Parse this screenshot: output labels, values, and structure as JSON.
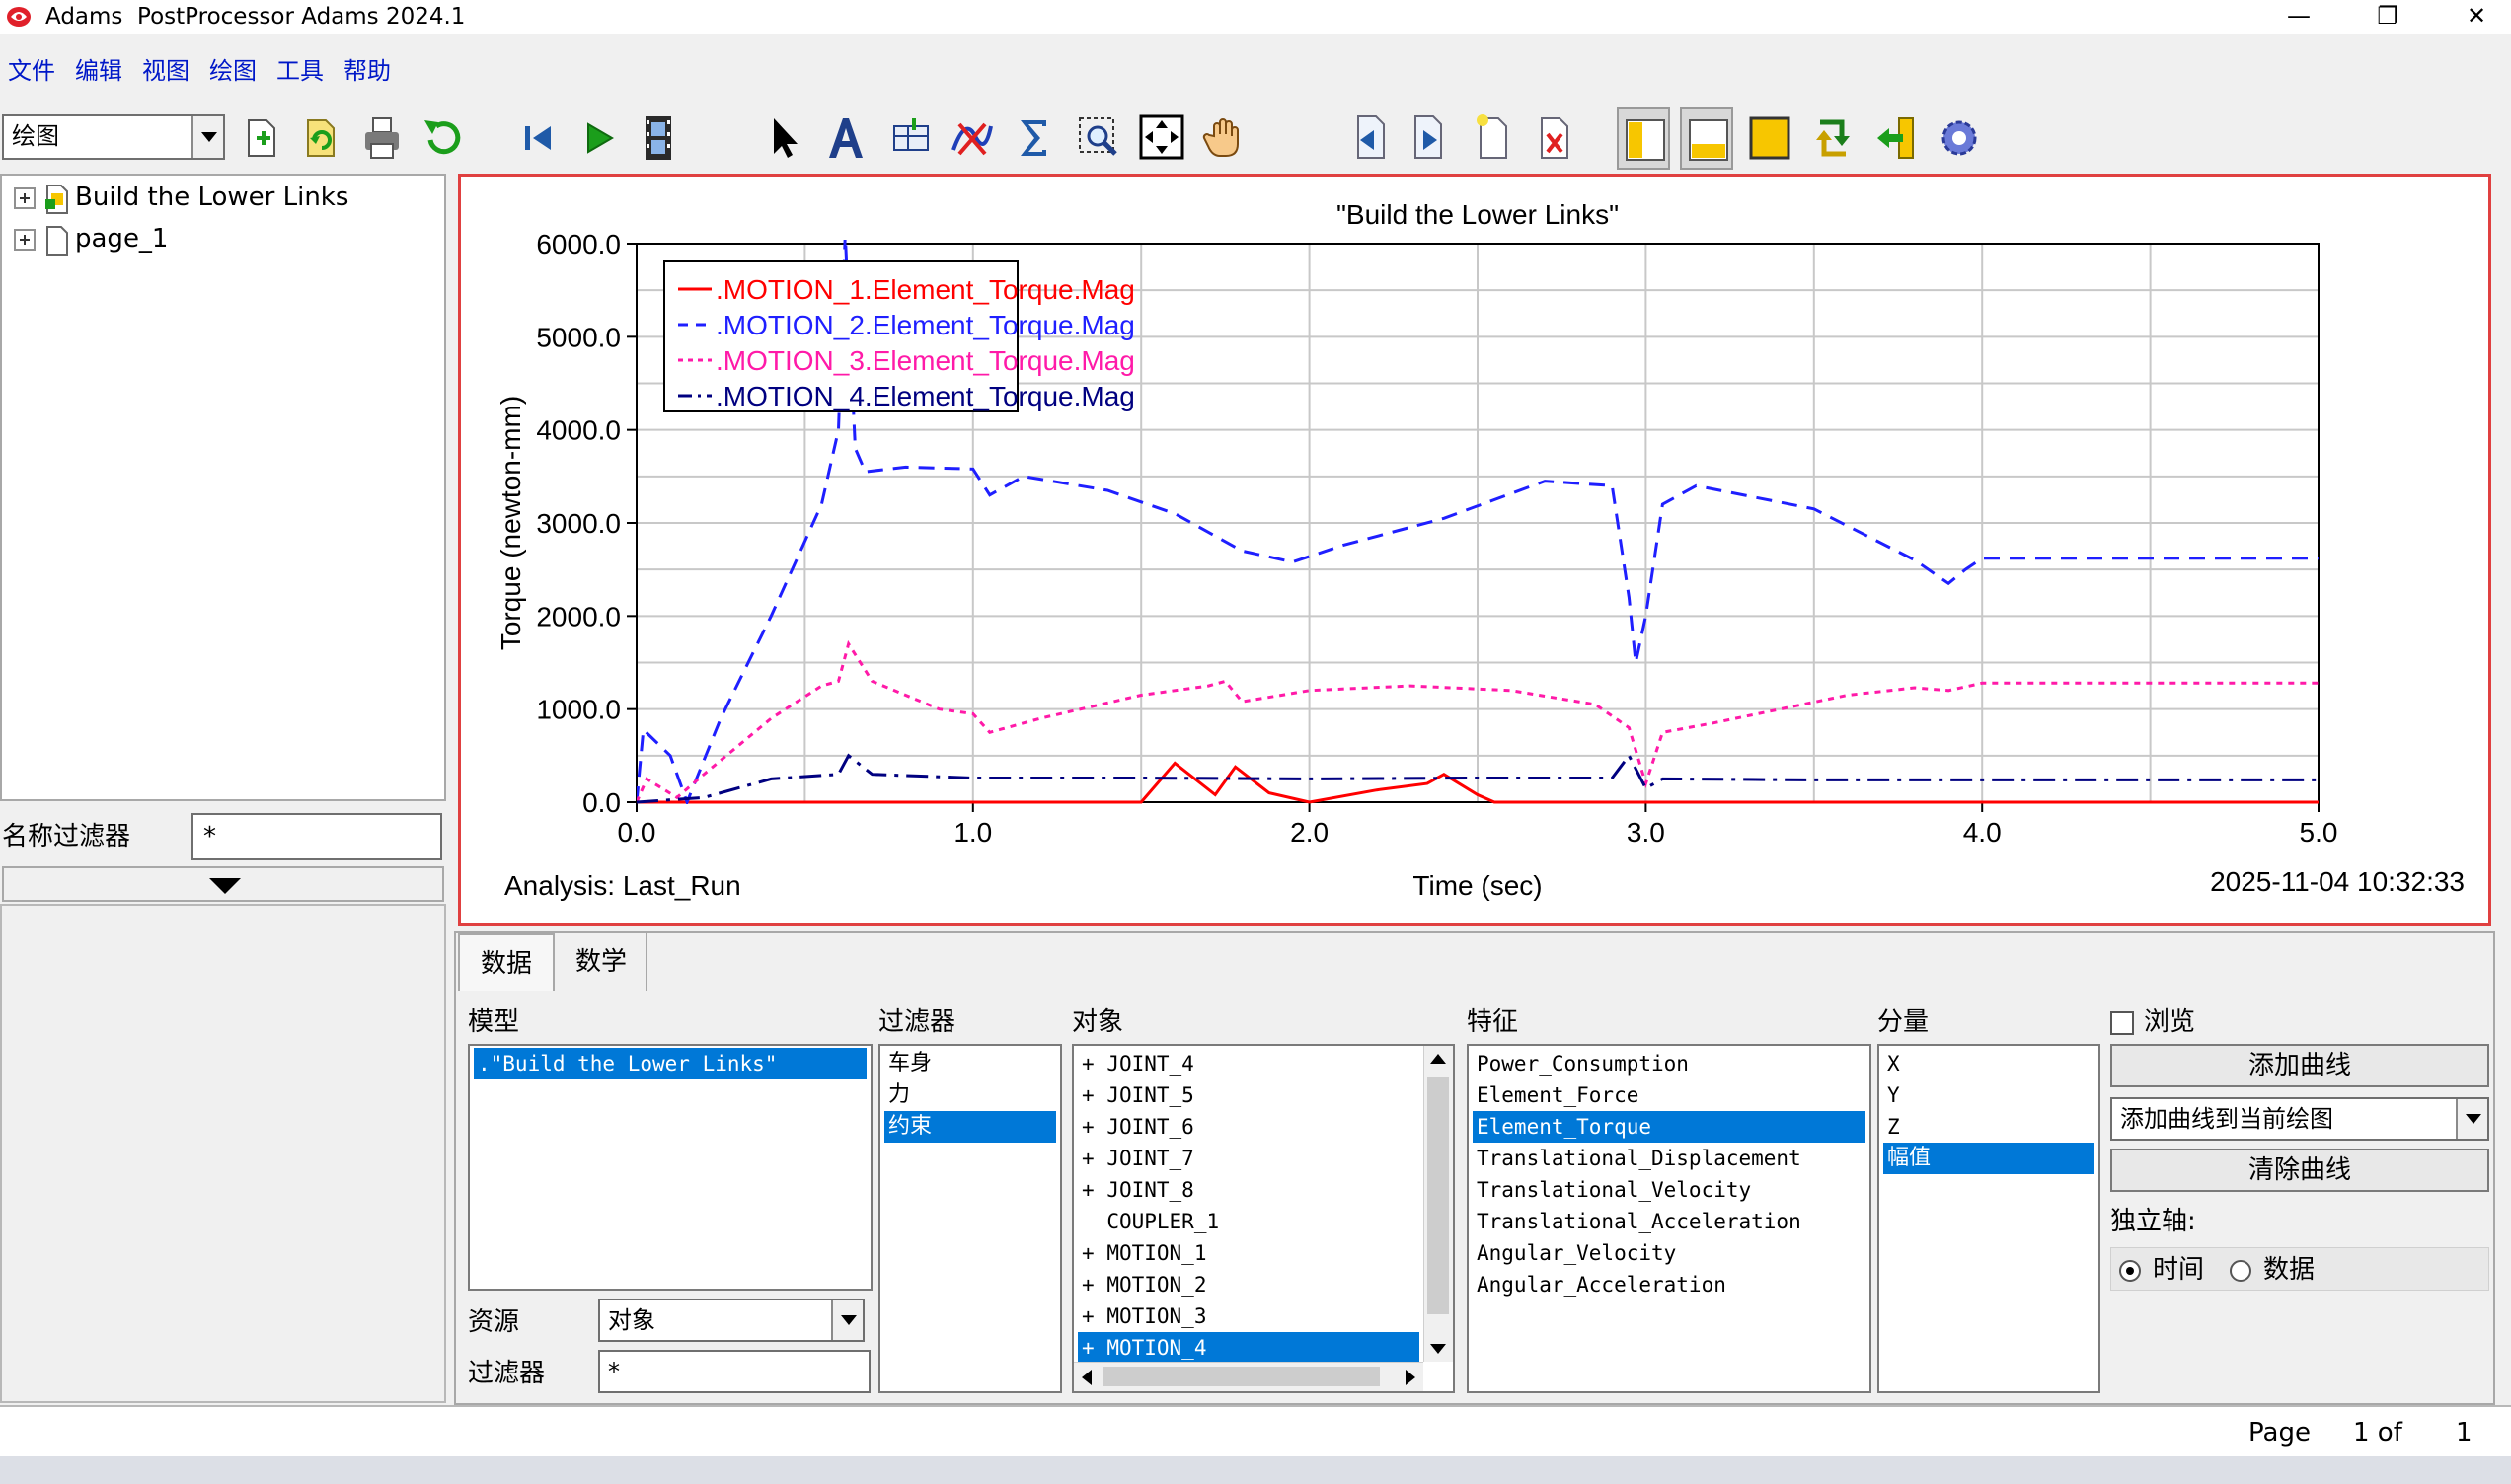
{
  "window": {
    "title": "Adams  PostProcessor Adams 2024.1",
    "controls": {
      "minimize": "—",
      "restore": "❐",
      "close": "✕"
    }
  },
  "menu": [
    "文件",
    "编辑",
    "视图",
    "绘图",
    "工具",
    "帮助"
  ],
  "toolbar": {
    "mode_select": "绘图",
    "icons": [
      "new-page-icon",
      "refresh-icon",
      "print-icon",
      "undo-icon",
      "first-frame-icon",
      "play-icon",
      "film-icon",
      "select-arrow-icon",
      "text-icon",
      "table-icon",
      "curve-edit-icon",
      "sum-icon",
      "zoom-box-icon",
      "fit-icon",
      "pan-hand-icon",
      "prev-page-icon",
      "next-page-icon",
      "new-page-sheet-icon",
      "delete-page-icon",
      "layout-split-left-icon",
      "layout-split-bottom-icon",
      "layout-single-icon",
      "swap-icon",
      "exit-icon",
      "settings-gear-icon"
    ]
  },
  "tree": {
    "items": [
      {
        "label": "Build the Lower Links",
        "icon": "model-icon"
      },
      {
        "label": "page_1",
        "icon": "page-icon"
      }
    ]
  },
  "name_filter": {
    "label": "名称过滤器",
    "value": "*"
  },
  "plot": {
    "analysis_label": "Analysis:  Last_Run",
    "timestamp": "2025-11-04 10:32:33"
  },
  "chart_data": {
    "type": "line",
    "title": "\"Build the Lower Links\"",
    "xlabel": "Time (sec)",
    "ylabel": "Torque (newton-mm)",
    "xlim": [
      0,
      5
    ],
    "ylim": [
      0,
      6000
    ],
    "x_ticks": [
      "0.0",
      "1.0",
      "2.0",
      "3.0",
      "4.0",
      "5.0"
    ],
    "y_ticks": [
      "0.0",
      "1000.0",
      "2000.0",
      "3000.0",
      "4000.0",
      "5000.0",
      "6000.0"
    ],
    "grid": true,
    "legend_position": "top-left",
    "series": [
      {
        "name": ".MOTION_1.Element_Torque.Mag",
        "color": "#ff0000",
        "dash": "solid",
        "points": [
          [
            0,
            0
          ],
          [
            1.5,
            0
          ],
          [
            1.6,
            420
          ],
          [
            1.72,
            80
          ],
          [
            1.78,
            380
          ],
          [
            1.88,
            100
          ],
          [
            2.0,
            0
          ],
          [
            2.2,
            130
          ],
          [
            2.35,
            200
          ],
          [
            2.4,
            300
          ],
          [
            2.5,
            80
          ],
          [
            2.55,
            0
          ],
          [
            5.0,
            0
          ]
        ]
      },
      {
        "name": ".MOTION_2.Element_Torque.Mag",
        "color": "#1f1fff",
        "dash": "dash",
        "points": [
          [
            0,
            0
          ],
          [
            0.02,
            780
          ],
          [
            0.1,
            500
          ],
          [
            0.15,
            0
          ],
          [
            0.25,
            900
          ],
          [
            0.4,
            2000
          ],
          [
            0.55,
            3200
          ],
          [
            0.6,
            4000
          ],
          [
            0.62,
            6100
          ],
          [
            0.65,
            3800
          ],
          [
            0.68,
            3550
          ],
          [
            0.8,
            3600
          ],
          [
            1.0,
            3580
          ],
          [
            1.05,
            3300
          ],
          [
            1.15,
            3500
          ],
          [
            1.4,
            3350
          ],
          [
            1.6,
            3100
          ],
          [
            1.8,
            2700
          ],
          [
            1.95,
            2580
          ],
          [
            2.1,
            2760
          ],
          [
            2.4,
            3050
          ],
          [
            2.7,
            3450
          ],
          [
            2.9,
            3400
          ],
          [
            2.95,
            2200
          ],
          [
            2.97,
            1500
          ],
          [
            3.0,
            2000
          ],
          [
            3.05,
            3200
          ],
          [
            3.15,
            3400
          ],
          [
            3.5,
            3150
          ],
          [
            3.8,
            2600
          ],
          [
            3.9,
            2350
          ],
          [
            3.95,
            2500
          ],
          [
            4.0,
            2620
          ],
          [
            5.0,
            2620
          ]
        ]
      },
      {
        "name": ".MOTION_3.Element_Torque.Mag",
        "color": "#ff1aa8",
        "dash": "dot",
        "points": [
          [
            0,
            0
          ],
          [
            0.03,
            250
          ],
          [
            0.12,
            50
          ],
          [
            0.2,
            300
          ],
          [
            0.4,
            900
          ],
          [
            0.55,
            1250
          ],
          [
            0.6,
            1300
          ],
          [
            0.63,
            1700
          ],
          [
            0.7,
            1300
          ],
          [
            0.9,
            1000
          ],
          [
            1.0,
            950
          ],
          [
            1.05,
            750
          ],
          [
            1.2,
            900
          ],
          [
            1.5,
            1150
          ],
          [
            1.7,
            1250
          ],
          [
            1.75,
            1300
          ],
          [
            1.8,
            1080
          ],
          [
            2.0,
            1200
          ],
          [
            2.3,
            1250
          ],
          [
            2.6,
            1200
          ],
          [
            2.85,
            1050
          ],
          [
            2.95,
            800
          ],
          [
            3.0,
            200
          ],
          [
            3.05,
            750
          ],
          [
            3.2,
            850
          ],
          [
            3.6,
            1150
          ],
          [
            3.8,
            1230
          ],
          [
            3.9,
            1200
          ],
          [
            4.0,
            1280
          ],
          [
            5.0,
            1280
          ]
        ]
      },
      {
        "name": ".MOTION_4.Element_Torque.Mag",
        "color": "#000080",
        "dash": "dashdot",
        "points": [
          [
            0,
            0
          ],
          [
            0.2,
            50
          ],
          [
            0.4,
            250
          ],
          [
            0.6,
            300
          ],
          [
            0.63,
            500
          ],
          [
            0.7,
            300
          ],
          [
            1.0,
            260
          ],
          [
            1.5,
            260
          ],
          [
            2.0,
            250
          ],
          [
            2.5,
            260
          ],
          [
            2.9,
            260
          ],
          [
            2.95,
            500
          ],
          [
            3.0,
            150
          ],
          [
            3.05,
            250
          ],
          [
            3.5,
            240
          ],
          [
            4.0,
            240
          ],
          [
            5.0,
            240
          ]
        ]
      }
    ]
  },
  "bottom": {
    "tabs": [
      "数据",
      "数学"
    ],
    "model": {
      "label": "模型",
      "items": [
        ".\"Build the Lower Links\""
      ],
      "selected": 0
    },
    "source": {
      "label": "资源",
      "value": "对象"
    },
    "filter_bottom": {
      "label": "过滤器",
      "value": "*"
    },
    "filter": {
      "label": "过滤器",
      "items": [
        "车身",
        "力",
        "约束"
      ],
      "selected": 2
    },
    "objects": {
      "label": "对象",
      "items": [
        {
          "prefix": "+",
          "name": "JOINT_4"
        },
        {
          "prefix": "+",
          "name": "JOINT_5"
        },
        {
          "prefix": "+",
          "name": "JOINT_6"
        },
        {
          "prefix": "+",
          "name": "JOINT_7"
        },
        {
          "prefix": "+",
          "name": "JOINT_8"
        },
        {
          "prefix": " ",
          "name": "COUPLER_1"
        },
        {
          "prefix": "+",
          "name": "MOTION_1"
        },
        {
          "prefix": "+",
          "name": "MOTION_2"
        },
        {
          "prefix": "+",
          "name": "MOTION_3"
        },
        {
          "prefix": "+",
          "name": "MOTION_4"
        }
      ],
      "selected": 9
    },
    "characteristic": {
      "label": "特征",
      "items": [
        "Power_Consumption",
        "Element_Force",
        "Element_Torque",
        "Translational_Displacement",
        "Translational_Velocity",
        "Translational_Acceleration",
        "Angular_Velocity",
        "Angular_Acceleration"
      ],
      "selected": 2
    },
    "component": {
      "label": "分量",
      "items": [
        "X",
        "Y",
        "Z",
        "幅值"
      ],
      "selected": 3
    },
    "browse": {
      "label": "浏览",
      "checked": false
    },
    "add_curve_button": "添加曲线",
    "add_target_select": "添加曲线到当前绘图",
    "clear_curve_button": "清除曲线",
    "independent_axis": {
      "label": "独立轴:",
      "options": [
        "时间",
        "数据"
      ],
      "selected": 0
    }
  },
  "status": {
    "page_label": "Page",
    "page_info": "1 of",
    "page_total": "1"
  }
}
